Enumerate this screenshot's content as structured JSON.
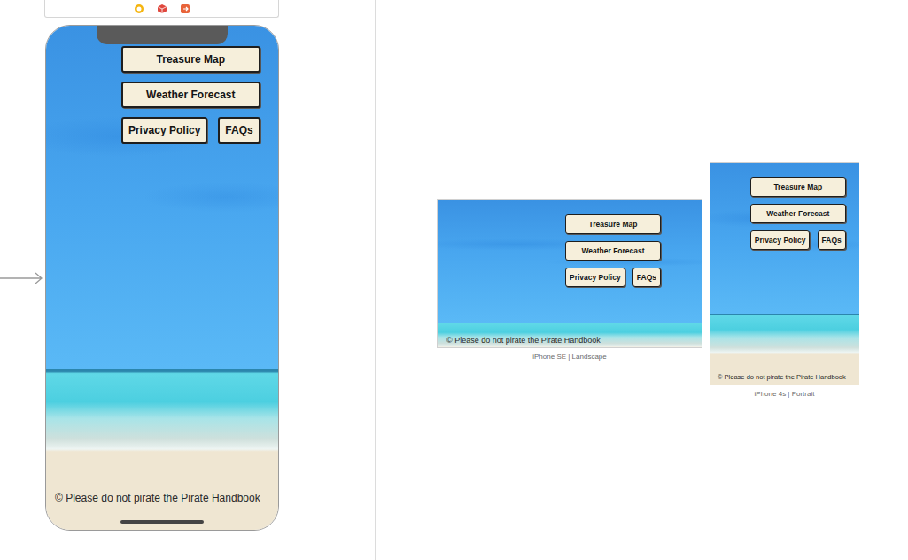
{
  "storyboard": {
    "scene": {
      "button_rows": [
        [
          "Treasure Map"
        ],
        [
          "Weather Forecast"
        ],
        [
          "Privacy Policy",
          "FAQs"
        ]
      ],
      "footer": "© Please do not pirate the Pirate Handbook"
    }
  },
  "previews": [
    {
      "label": "iPhone SE | Landscape",
      "kind": "landscape"
    },
    {
      "label": "iPhone 4s | Portrait",
      "kind": "portrait"
    }
  ]
}
